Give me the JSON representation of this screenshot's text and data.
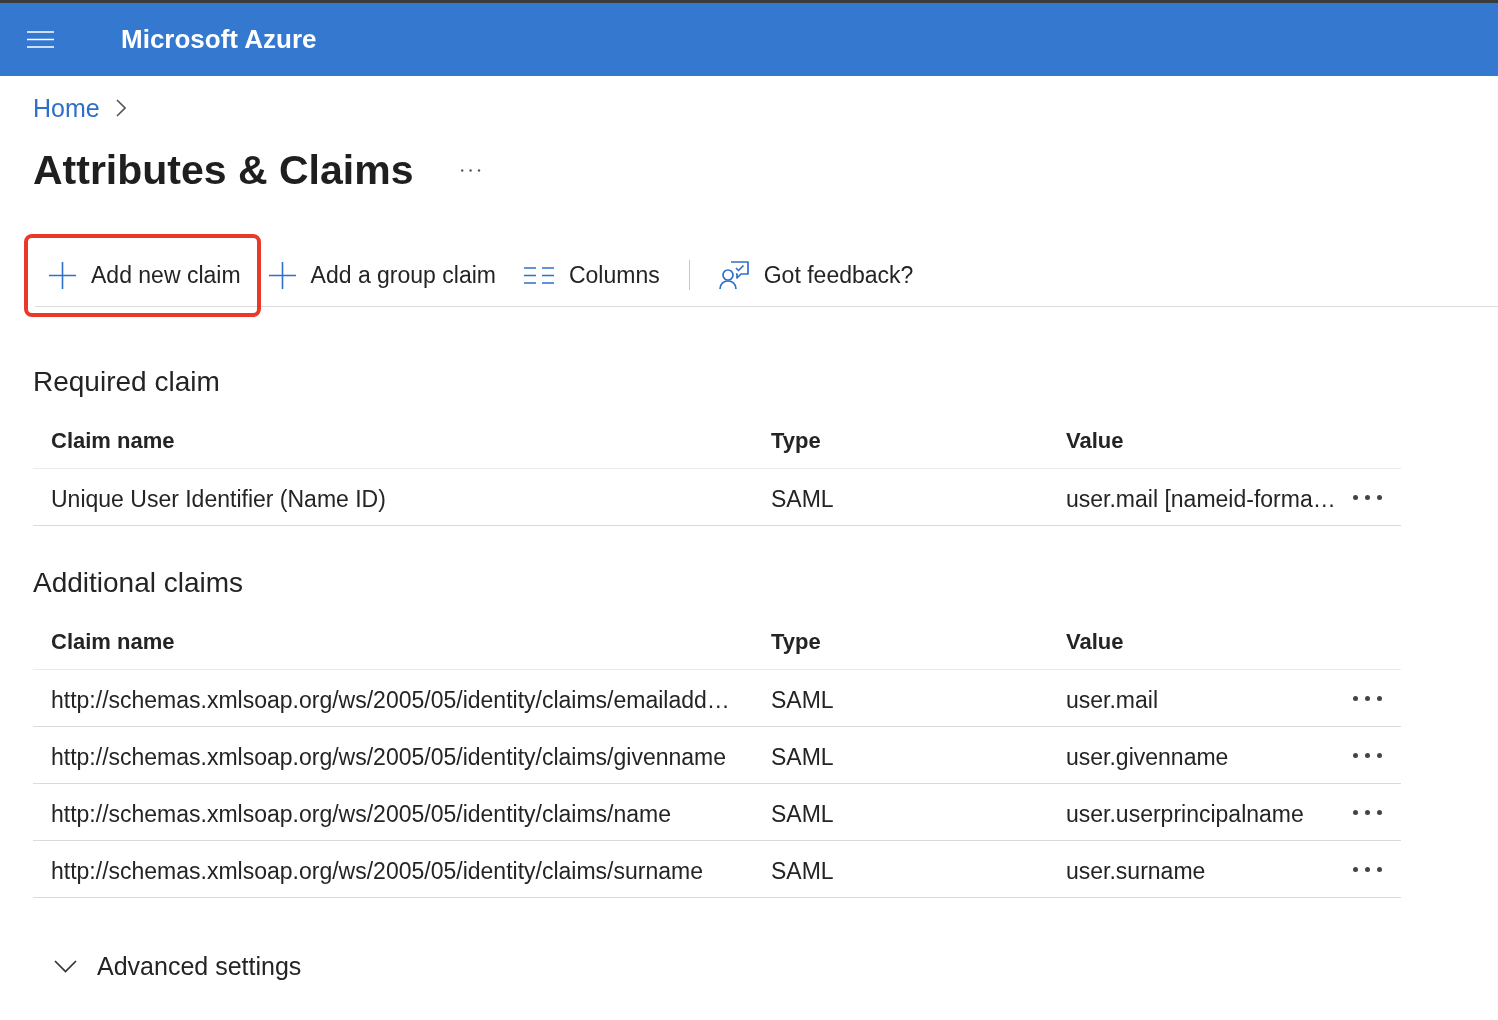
{
  "header": {
    "title": "Microsoft Azure"
  },
  "breadcrumb": [
    {
      "label": "Home"
    }
  ],
  "page": {
    "title": "Attributes & Claims"
  },
  "toolbar": [
    {
      "kind": "add",
      "label": "Add new claim",
      "highlighted": true
    },
    {
      "kind": "add",
      "label": "Add a group claim",
      "highlighted": false
    },
    {
      "kind": "columns",
      "label": "Columns",
      "highlighted": false
    },
    {
      "kind": "feedback",
      "label": "Got feedback?",
      "highlighted": false
    }
  ],
  "sections": [
    {
      "title": "Required claim",
      "table": {
        "columns": [
          "Claim name",
          "Type",
          "Value"
        ],
        "rows": [
          {
            "claim_name": "Unique User Identifier (Name ID)",
            "type": "SAML",
            "value": "user.mail [nameid-forma…"
          }
        ]
      }
    },
    {
      "title": "Additional claims",
      "table": {
        "columns": [
          "Claim name",
          "Type",
          "Value"
        ],
        "rows": [
          {
            "claim_name": "http://schemas.xmlsoap.org/ws/2005/05/identity/claims/emailadd…",
            "type": "SAML",
            "value": "user.mail"
          },
          {
            "claim_name": "http://schemas.xmlsoap.org/ws/2005/05/identity/claims/givenname",
            "type": "SAML",
            "value": "user.givenname"
          },
          {
            "claim_name": "http://schemas.xmlsoap.org/ws/2005/05/identity/claims/name",
            "type": "SAML",
            "value": "user.userprincipalname"
          },
          {
            "claim_name": "http://schemas.xmlsoap.org/ws/2005/05/identity/claims/surname",
            "type": "SAML",
            "value": "user.surname"
          }
        ]
      }
    }
  ],
  "advanced_settings": {
    "label": "Advanced settings",
    "expanded": false
  }
}
